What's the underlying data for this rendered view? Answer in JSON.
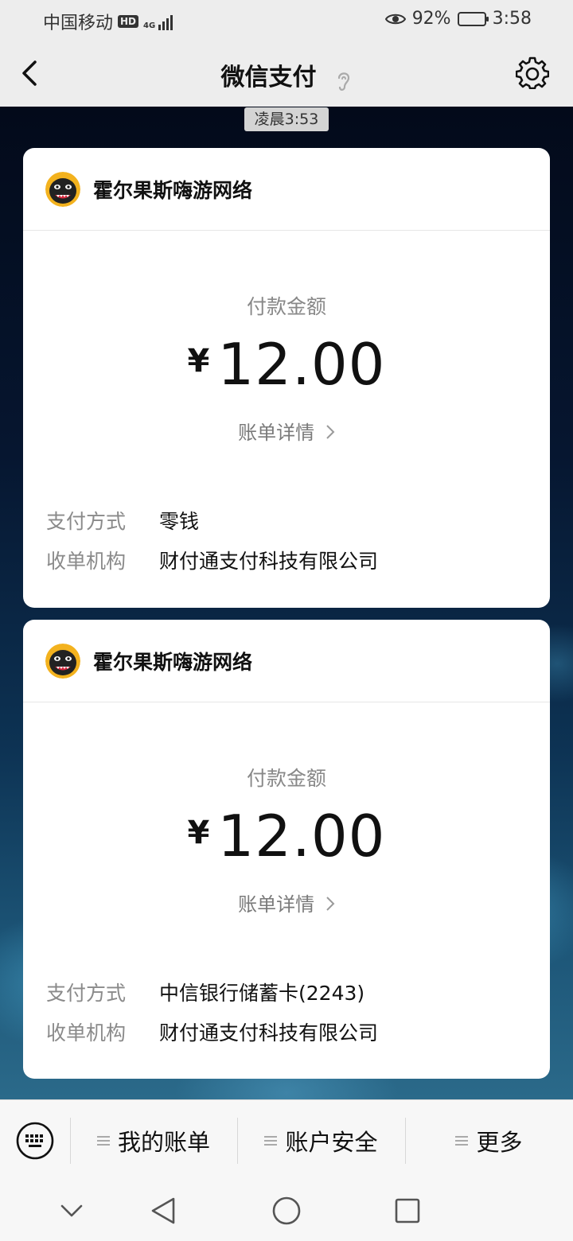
{
  "status_bar": {
    "carrier": "中国移动",
    "hd": "HD",
    "network": "4G",
    "battery": "92%",
    "time": "3:58"
  },
  "nav": {
    "title": "微信支付"
  },
  "chat": {
    "timestamp": "凌晨3:53",
    "cards": [
      {
        "merchant": "霍尔果斯嗨游网络",
        "amount_label": "付款金额",
        "currency": "¥",
        "amount": "12.00",
        "detail_link": "账单详情",
        "rows": [
          {
            "key": "支付方式",
            "value": "零钱"
          },
          {
            "key": "收单机构",
            "value": "财付通支付科技有限公司"
          }
        ]
      },
      {
        "merchant": "霍尔果斯嗨游网络",
        "amount_label": "付款金额",
        "currency": "¥",
        "amount": "12.00",
        "detail_link": "账单详情",
        "rows": [
          {
            "key": "支付方式",
            "value": "中信银行储蓄卡(2243)"
          },
          {
            "key": "收单机构",
            "value": "财付通支付科技有限公司"
          }
        ]
      }
    ]
  },
  "bottom_menu": {
    "items": [
      {
        "label": "我的账单"
      },
      {
        "label": "账户安全"
      },
      {
        "label": "更多"
      }
    ]
  }
}
